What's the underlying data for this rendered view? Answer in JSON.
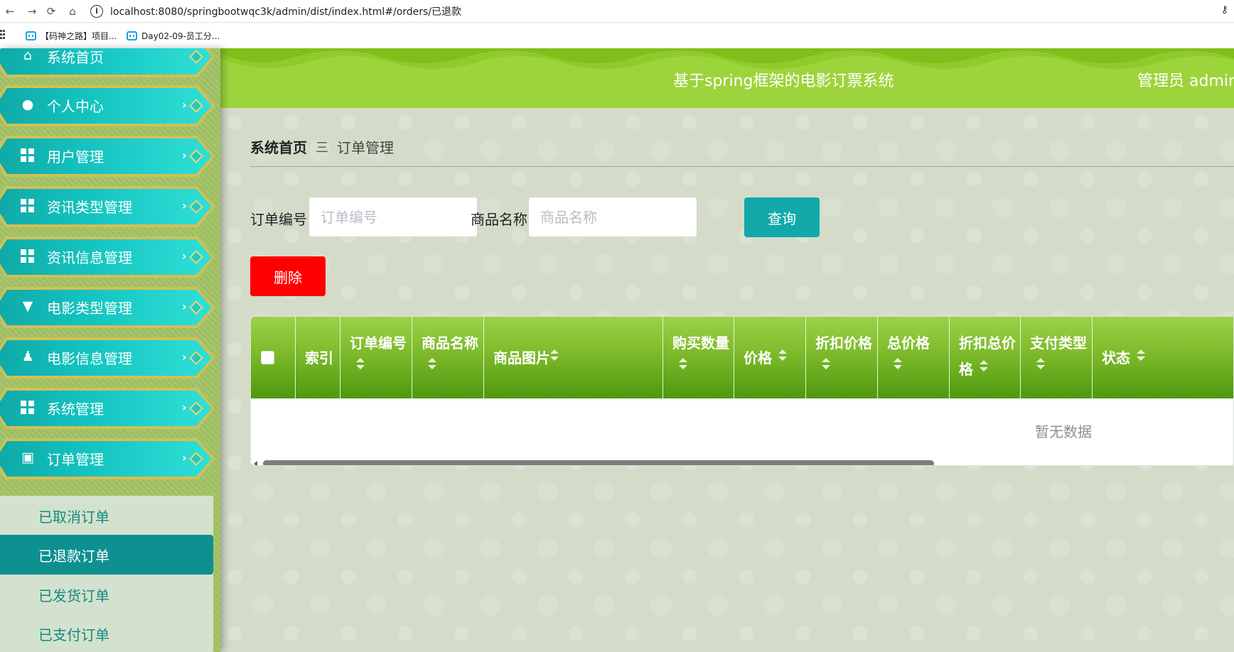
{
  "browser": {
    "url": "localhost:8080/springbootwqc3k/admin/dist/index.html#/orders/已退款",
    "bookmarks": [
      "【码神之路】项目...",
      "Day02-09-员工分..."
    ]
  },
  "header": {
    "title": "基于spring框架的电影订票系统",
    "user": "管理员 admin"
  },
  "sidebar": {
    "items": [
      {
        "label": "系统首页",
        "icon": "home-icon"
      },
      {
        "label": "个人中心",
        "icon": "user-icon"
      },
      {
        "label": "用户管理",
        "icon": "grid-icon"
      },
      {
        "label": "资讯类型管理",
        "icon": "grid-icon"
      },
      {
        "label": "资讯信息管理",
        "icon": "grid-icon"
      },
      {
        "label": "电影类型管理",
        "icon": "pin-icon"
      },
      {
        "label": "电影信息管理",
        "icon": "stamp-icon"
      },
      {
        "label": "系统管理",
        "icon": "grid-icon"
      },
      {
        "label": "订单管理",
        "icon": "chat-icon"
      }
    ],
    "submenu": [
      {
        "label": "已取消订单",
        "active": false
      },
      {
        "label": "已退款订单",
        "active": true
      },
      {
        "label": "已发货订单",
        "active": false
      },
      {
        "label": "已支付订单",
        "active": false
      }
    ]
  },
  "breadcrumb": {
    "home": "系统首页",
    "separator": "三",
    "current": "订单管理"
  },
  "search": {
    "order_no_label": "订单编号",
    "order_no_placeholder": "订单编号",
    "product_label": "商品名称",
    "product_placeholder": "商品名称",
    "query_button": "查询"
  },
  "actions": {
    "delete_button": "删除"
  },
  "table": {
    "columns": [
      {
        "line1": "索引",
        "line2": "",
        "sortable": false
      },
      {
        "line1": "订单编号",
        "line2": "",
        "sortable": true
      },
      {
        "line1": "商品名称",
        "line2": "",
        "sortable": true
      },
      {
        "line1": "商品图片",
        "line2": "",
        "sortable": true
      },
      {
        "line1": "购买数量",
        "line2": "",
        "sortable": true
      },
      {
        "line1": "价格",
        "line2": "",
        "sortable": true
      },
      {
        "line1": "折扣价格",
        "line2": "",
        "sortable": true
      },
      {
        "line1": "总价格",
        "line2": "",
        "sortable": true
      },
      {
        "line1": "折扣总价",
        "line2": "格",
        "sortable": true
      },
      {
        "line1": "支付类型",
        "line2": "",
        "sortable": true
      },
      {
        "line1": "状态",
        "line2": "",
        "sortable": true
      }
    ],
    "empty_text": "暂无数据"
  },
  "colors": {
    "header_green": "#8fcb2a",
    "menu_teal": "#13c2bf",
    "active_sub": "#0f9090",
    "query_button": "#11a9a9",
    "delete_button": "#ff0000"
  }
}
